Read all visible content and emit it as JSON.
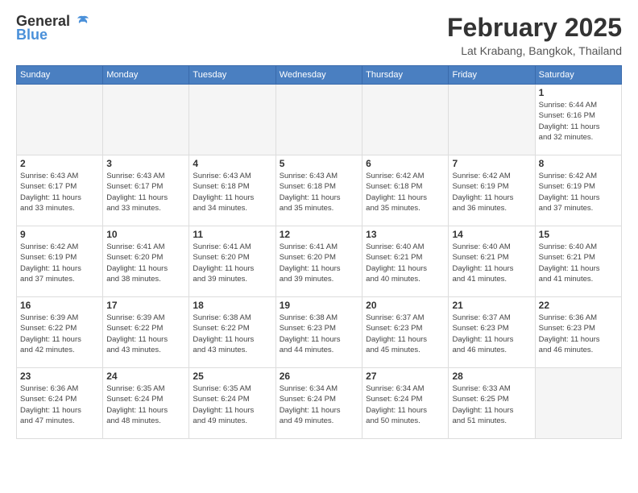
{
  "header": {
    "logo_general": "General",
    "logo_blue": "Blue",
    "title": "February 2025",
    "location": "Lat Krabang, Bangkok, Thailand"
  },
  "calendar": {
    "days_of_week": [
      "Sunday",
      "Monday",
      "Tuesday",
      "Wednesday",
      "Thursday",
      "Friday",
      "Saturday"
    ],
    "weeks": [
      [
        {
          "day": "",
          "info": "",
          "empty": true
        },
        {
          "day": "",
          "info": "",
          "empty": true
        },
        {
          "day": "",
          "info": "",
          "empty": true
        },
        {
          "day": "",
          "info": "",
          "empty": true
        },
        {
          "day": "",
          "info": "",
          "empty": true
        },
        {
          "day": "",
          "info": "",
          "empty": true
        },
        {
          "day": "1",
          "info": "Sunrise: 6:44 AM\nSunset: 6:16 PM\nDaylight: 11 hours\nand 32 minutes.",
          "empty": false
        }
      ],
      [
        {
          "day": "2",
          "info": "Sunrise: 6:43 AM\nSunset: 6:17 PM\nDaylight: 11 hours\nand 33 minutes.",
          "empty": false
        },
        {
          "day": "3",
          "info": "Sunrise: 6:43 AM\nSunset: 6:17 PM\nDaylight: 11 hours\nand 33 minutes.",
          "empty": false
        },
        {
          "day": "4",
          "info": "Sunrise: 6:43 AM\nSunset: 6:18 PM\nDaylight: 11 hours\nand 34 minutes.",
          "empty": false
        },
        {
          "day": "5",
          "info": "Sunrise: 6:43 AM\nSunset: 6:18 PM\nDaylight: 11 hours\nand 35 minutes.",
          "empty": false
        },
        {
          "day": "6",
          "info": "Sunrise: 6:42 AM\nSunset: 6:18 PM\nDaylight: 11 hours\nand 35 minutes.",
          "empty": false
        },
        {
          "day": "7",
          "info": "Sunrise: 6:42 AM\nSunset: 6:19 PM\nDaylight: 11 hours\nand 36 minutes.",
          "empty": false
        },
        {
          "day": "8",
          "info": "Sunrise: 6:42 AM\nSunset: 6:19 PM\nDaylight: 11 hours\nand 37 minutes.",
          "empty": false
        }
      ],
      [
        {
          "day": "9",
          "info": "Sunrise: 6:42 AM\nSunset: 6:19 PM\nDaylight: 11 hours\nand 37 minutes.",
          "empty": false
        },
        {
          "day": "10",
          "info": "Sunrise: 6:41 AM\nSunset: 6:20 PM\nDaylight: 11 hours\nand 38 minutes.",
          "empty": false
        },
        {
          "day": "11",
          "info": "Sunrise: 6:41 AM\nSunset: 6:20 PM\nDaylight: 11 hours\nand 39 minutes.",
          "empty": false
        },
        {
          "day": "12",
          "info": "Sunrise: 6:41 AM\nSunset: 6:20 PM\nDaylight: 11 hours\nand 39 minutes.",
          "empty": false
        },
        {
          "day": "13",
          "info": "Sunrise: 6:40 AM\nSunset: 6:21 PM\nDaylight: 11 hours\nand 40 minutes.",
          "empty": false
        },
        {
          "day": "14",
          "info": "Sunrise: 6:40 AM\nSunset: 6:21 PM\nDaylight: 11 hours\nand 41 minutes.",
          "empty": false
        },
        {
          "day": "15",
          "info": "Sunrise: 6:40 AM\nSunset: 6:21 PM\nDaylight: 11 hours\nand 41 minutes.",
          "empty": false
        }
      ],
      [
        {
          "day": "16",
          "info": "Sunrise: 6:39 AM\nSunset: 6:22 PM\nDaylight: 11 hours\nand 42 minutes.",
          "empty": false
        },
        {
          "day": "17",
          "info": "Sunrise: 6:39 AM\nSunset: 6:22 PM\nDaylight: 11 hours\nand 43 minutes.",
          "empty": false
        },
        {
          "day": "18",
          "info": "Sunrise: 6:38 AM\nSunset: 6:22 PM\nDaylight: 11 hours\nand 43 minutes.",
          "empty": false
        },
        {
          "day": "19",
          "info": "Sunrise: 6:38 AM\nSunset: 6:23 PM\nDaylight: 11 hours\nand 44 minutes.",
          "empty": false
        },
        {
          "day": "20",
          "info": "Sunrise: 6:37 AM\nSunset: 6:23 PM\nDaylight: 11 hours\nand 45 minutes.",
          "empty": false
        },
        {
          "day": "21",
          "info": "Sunrise: 6:37 AM\nSunset: 6:23 PM\nDaylight: 11 hours\nand 46 minutes.",
          "empty": false
        },
        {
          "day": "22",
          "info": "Sunrise: 6:36 AM\nSunset: 6:23 PM\nDaylight: 11 hours\nand 46 minutes.",
          "empty": false
        }
      ],
      [
        {
          "day": "23",
          "info": "Sunrise: 6:36 AM\nSunset: 6:24 PM\nDaylight: 11 hours\nand 47 minutes.",
          "empty": false
        },
        {
          "day": "24",
          "info": "Sunrise: 6:35 AM\nSunset: 6:24 PM\nDaylight: 11 hours\nand 48 minutes.",
          "empty": false
        },
        {
          "day": "25",
          "info": "Sunrise: 6:35 AM\nSunset: 6:24 PM\nDaylight: 11 hours\nand 49 minutes.",
          "empty": false
        },
        {
          "day": "26",
          "info": "Sunrise: 6:34 AM\nSunset: 6:24 PM\nDaylight: 11 hours\nand 49 minutes.",
          "empty": false
        },
        {
          "day": "27",
          "info": "Sunrise: 6:34 AM\nSunset: 6:24 PM\nDaylight: 11 hours\nand 50 minutes.",
          "empty": false
        },
        {
          "day": "28",
          "info": "Sunrise: 6:33 AM\nSunset: 6:25 PM\nDaylight: 11 hours\nand 51 minutes.",
          "empty": false
        },
        {
          "day": "",
          "info": "",
          "empty": true
        }
      ]
    ]
  }
}
